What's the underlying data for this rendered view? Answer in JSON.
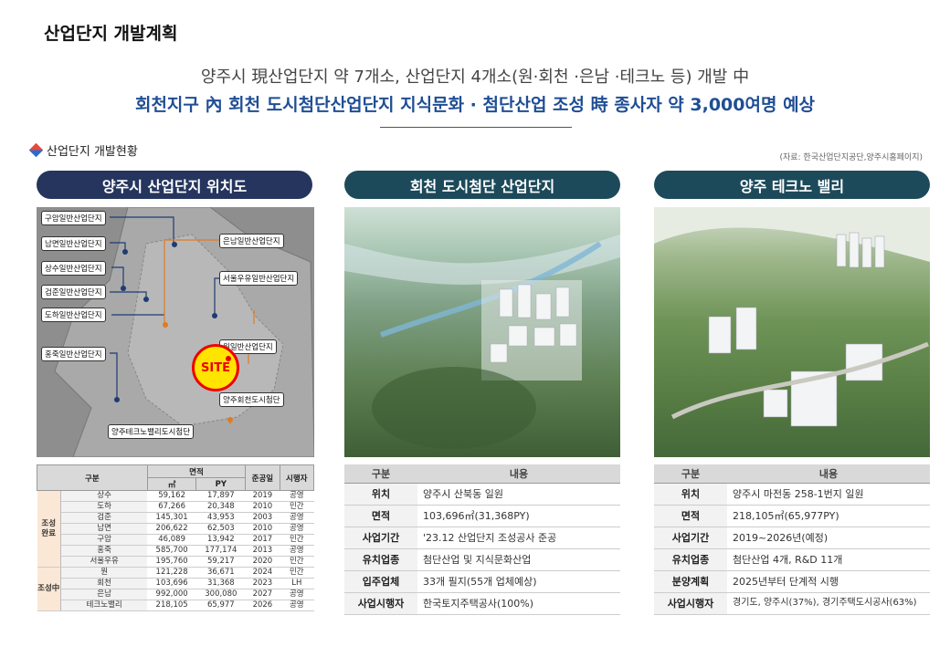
{
  "title": "산업단지 개발계획",
  "subtitle1": "양주시 現산업단지 약 7개소, 산업단지 4개소(원·회천 ·은남 ·테크노 등) 개발 中",
  "subtitle2": "회천지구 內 회천 도시첨단산업단지 지식문화 · 첨단산업 조성 時 종사자 약 3,000여명 예상",
  "section_title": "산업단지 개발현황",
  "source": "(자료: 한국산업단지공단,양주시홈페이지)",
  "colors": {
    "navy_pill": "#25355e",
    "teal_pill": "#1d4a5a",
    "accent_blue": "#1f4e94",
    "site_red": "#e00000",
    "site_yellow": "#ffe400",
    "label_group_bg": "#fbe7d5"
  },
  "panels": {
    "map": {
      "header": "양주시 산업단지 위치도",
      "site_label": "SITE",
      "labels_left": [
        "구암일반산업단지",
        "남면일반산업단지",
        "상수일반산업단지",
        "검준일반산업단지",
        "도하일반산업단지",
        "홍죽일반산업단지"
      ],
      "labels_right": [
        "은남일반산업단지",
        "서울우유일반산업단지",
        "원일반산업단지",
        "양주회천도시첨단"
      ],
      "label_bottom": "양주테크노밸리도시첨단"
    },
    "hoecheon": {
      "header": "회천 도시첨단 산업단지",
      "image_desc": "aerial-rendering"
    },
    "techno": {
      "header": "양주 테크노 밸리",
      "image_desc": "aerial-rendering"
    }
  },
  "table_main": {
    "headers": {
      "gubun": "구분",
      "area": "면적",
      "m2": "㎡",
      "py": "PY",
      "done": "준공일",
      "exec": "시행자"
    },
    "group1": "조성 완료",
    "group2": "조성中",
    "rows1": [
      [
        "상수",
        "59,162",
        "17,897",
        "2019",
        "공영"
      ],
      [
        "도하",
        "67,266",
        "20,348",
        "2010",
        "민간"
      ],
      [
        "검준",
        "145,301",
        "43,953",
        "2003",
        "공영"
      ],
      [
        "남면",
        "206,622",
        "62,503",
        "2010",
        "공영"
      ],
      [
        "구암",
        "46,089",
        "13,942",
        "2017",
        "민간"
      ],
      [
        "홍죽",
        "585,700",
        "177,174",
        "2013",
        "공영"
      ],
      [
        "서울우유",
        "195,760",
        "59,217",
        "2020",
        "민간"
      ]
    ],
    "rows2": [
      [
        "원",
        "121,228",
        "36,671",
        "2024",
        "민간"
      ],
      [
        "회천",
        "103,696",
        "31,368",
        "2023",
        "LH"
      ],
      [
        "은남",
        "992,000",
        "300,080",
        "2027",
        "공영"
      ],
      [
        "테크노밸리",
        "218,105",
        "65,977",
        "2026",
        "공영"
      ]
    ]
  },
  "table_hoecheon": {
    "col1": "구분",
    "col2": "내용",
    "rows": [
      [
        "위치",
        "양주시 산북동 일원"
      ],
      [
        "면적",
        "103,696㎡(31,368PY)"
      ],
      [
        "사업기간",
        "'23.12 산업단지 조성공사 준공"
      ],
      [
        "유치업종",
        "첨단산업 및 지식문화산업"
      ],
      [
        "입주업체",
        "33개 필지(55개 업체예상)"
      ],
      [
        "사업시행자",
        "한국토지주택공사(100%)"
      ]
    ]
  },
  "table_techno": {
    "col1": "구분",
    "col2": "내용",
    "rows": [
      [
        "위치",
        "양주시 마전동 258-1번지 일원"
      ],
      [
        "면적",
        "218,105㎡(65,977PY)"
      ],
      [
        "사업기간",
        "2019~2026년(예정)"
      ],
      [
        "유치업종",
        "첨단산업 4개, R&D 11개"
      ],
      [
        "분양계획",
        "2025년부터 단계적 시행"
      ],
      [
        "사업시행자",
        "경기도, 양주시(37%), 경기주택도시공사(63%)"
      ]
    ]
  }
}
